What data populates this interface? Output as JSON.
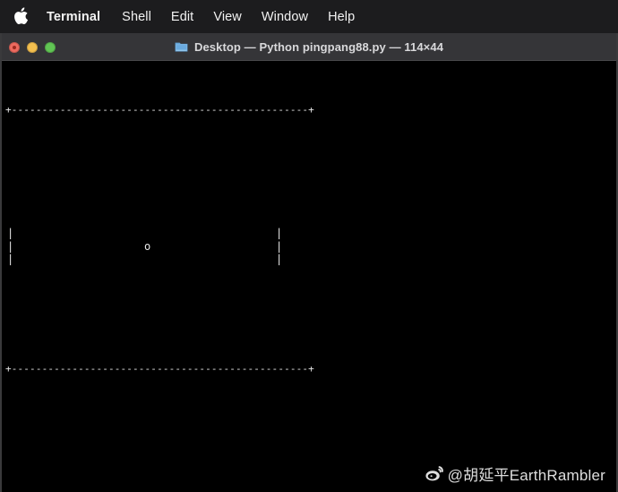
{
  "menubar": {
    "apple_icon": "apple-logo-icon",
    "items": [
      {
        "label": "Terminal",
        "bold": true
      },
      {
        "label": "Shell",
        "bold": false
      },
      {
        "label": "Edit",
        "bold": false
      },
      {
        "label": "View",
        "bold": false
      },
      {
        "label": "Window",
        "bold": false
      },
      {
        "label": "Help",
        "bold": false
      }
    ]
  },
  "window": {
    "traffic_lights": {
      "close_label": "Close",
      "minimize_label": "Minimize",
      "maximize_label": "Maximize",
      "close_color": "#ec6a5f",
      "minimize_color": "#f3bf4f",
      "maximize_color": "#61c554"
    },
    "folder_icon": "folder-icon",
    "title": "Desktop — Python pingpang88.py — 114×44",
    "title_parts": {
      "directory": "Desktop",
      "process": "Python pingpang88.py",
      "dimensions": "114×44"
    },
    "background_color": "#000000",
    "titlebar_color": "#353538"
  },
  "terminal": {
    "foreground_color": "#e8e8e8",
    "border_top": "+-------------------------------------------------+",
    "border_bottom": "+-------------------------------------------------+",
    "paddle_left": "|\n|\n|",
    "paddle_right": "|\n|\n|",
    "ball": "o",
    "ball_char": "o"
  },
  "watermark": {
    "icon": "weibo-logo-icon",
    "text": "@胡延平EarthRambler"
  }
}
